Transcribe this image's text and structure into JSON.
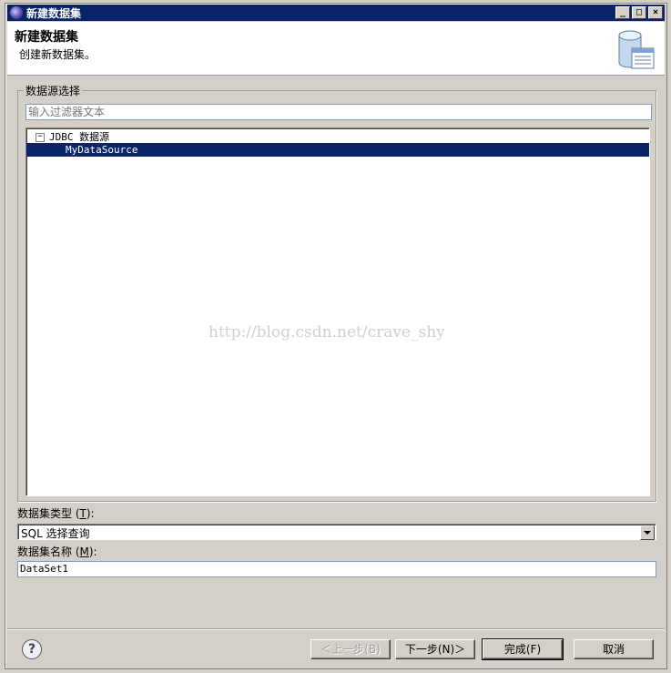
{
  "window": {
    "title": "新建数据集"
  },
  "banner": {
    "title": "新建数据集",
    "subtitle": "创建新数据集。",
    "image_icon": "database-table-icon"
  },
  "datasource_group": {
    "label": "数据源选择",
    "filter_placeholder": "输入过滤器文本",
    "tree": {
      "root_label": "JDBC 数据源",
      "root_expander": "−",
      "child_label": "MyDataSource"
    }
  },
  "watermark": "http://blog.csdn.net/crave_shy",
  "dataset_type": {
    "label_pre": "数据集类型 (",
    "label_mnemonic": "T",
    "label_post": "):",
    "value": "SQL 选择查询"
  },
  "dataset_name": {
    "label_pre": "数据集名称 (",
    "label_mnemonic": "M",
    "label_post": "):",
    "value": "DataSet1"
  },
  "buttons": {
    "back": "＜上一步(B)",
    "next": "下一步(N)＞",
    "finish": "完成(F)",
    "cancel": "取消",
    "help": "?"
  },
  "colors": {
    "selection": "#0a246a",
    "title_bar": "#0a246a",
    "dialog_bg": "#d4d0c8"
  }
}
